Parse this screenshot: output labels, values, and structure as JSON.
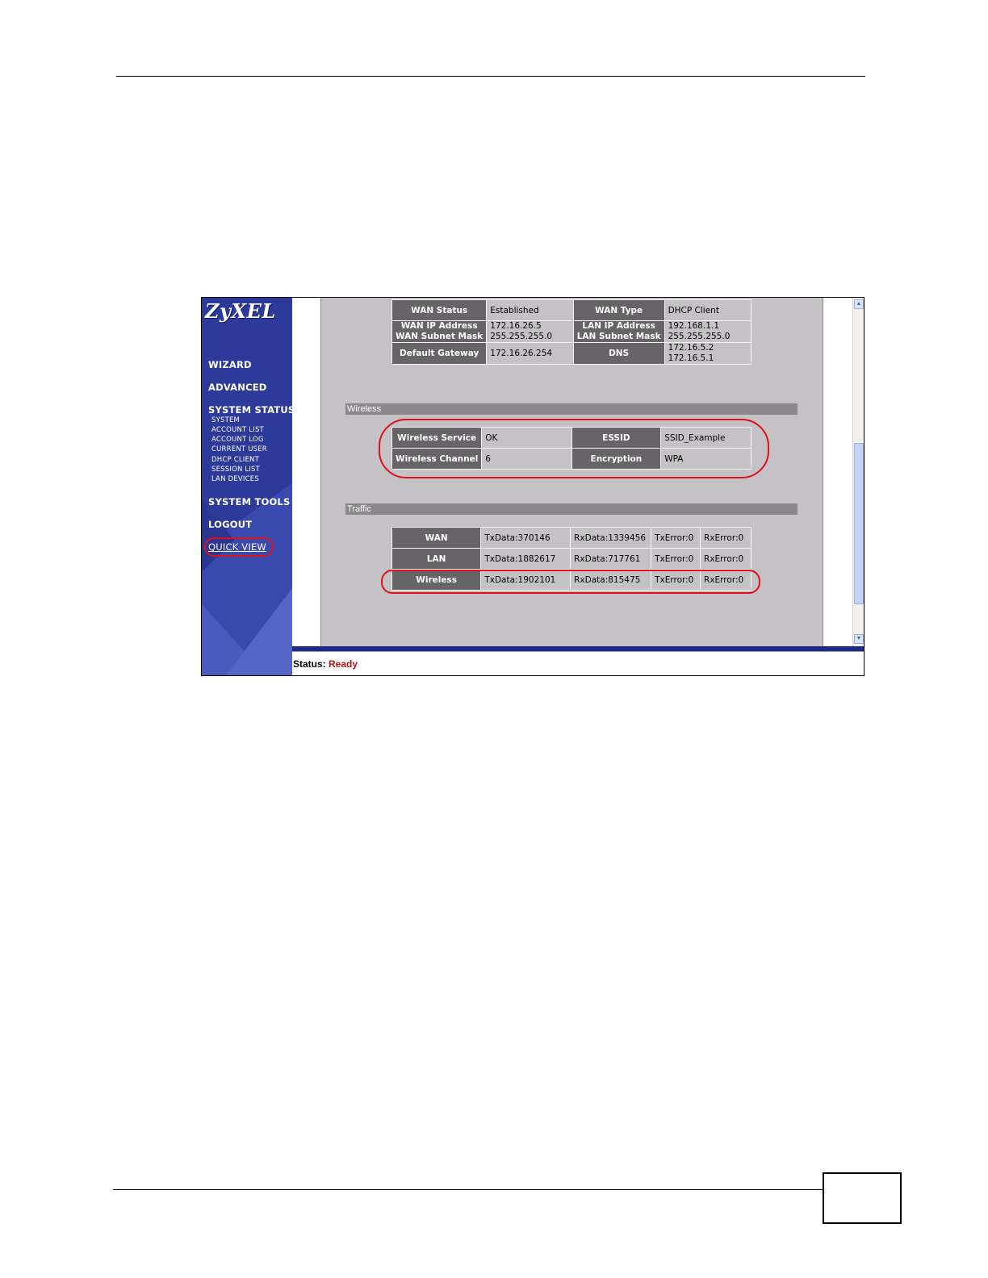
{
  "sidebar": {
    "logo": "ZyXEL",
    "wizard": "WIZARD",
    "advanced": "ADVANCED",
    "system_status": "SYSTEM STATUS",
    "sub_items": [
      "SYSTEM",
      "ACCOUNT LIST",
      "ACCOUNT LOG",
      "CURRENT USER",
      "DHCP CLIENT",
      "SESSION LIST",
      "LAN DEVICES"
    ],
    "system_tools": "SYSTEM TOOLS",
    "logout": "LOGOUT",
    "quick_view": "QUICK VIEW"
  },
  "wan": {
    "status_label": "WAN Status",
    "status_value": "Established",
    "type_label": "WAN Type",
    "type_value": "DHCP Client",
    "ip_label": "WAN IP Address",
    "mask_label": "WAN Subnet Mask",
    "ip_value": "172.16.26.5",
    "mask_value": "255.255.255.0",
    "lan_ip_label": "LAN IP Address",
    "lan_mask_label": "LAN Subnet Mask",
    "lan_ip_value": "192.168.1.1",
    "lan_mask_value": "255.255.255.0",
    "gateway_label": "Default Gateway",
    "gateway_value": "172.16.26.254",
    "dns_label": "DNS",
    "dns_value_1": "172.16.5.2",
    "dns_value_2": "172.16.5.1"
  },
  "wireless": {
    "section_title": "Wireless",
    "service_label": "Wireless Service",
    "service_value": "OK",
    "essid_label": "ESSID",
    "essid_value": "SSID_Example",
    "channel_label": "Wireless Channel",
    "channel_value": "6",
    "encryption_label": "Encryption",
    "encryption_value": "WPA"
  },
  "traffic": {
    "section_title": "Traffic",
    "rows": [
      {
        "name": "WAN",
        "tx": "TxData:370146",
        "rx": "RxData:1339456",
        "txerr": "TxError:0",
        "rxerr": "RxError:0"
      },
      {
        "name": "LAN",
        "tx": "TxData:1882617",
        "rx": "RxData:717761",
        "txerr": "TxError:0",
        "rxerr": "RxError:0"
      },
      {
        "name": "Wireless",
        "tx": "TxData:1902101",
        "rx": "RxData:815475",
        "txerr": "TxError:0",
        "rxerr": "RxError:0"
      }
    ]
  },
  "status_bar": {
    "label": "Status:",
    "value": "Ready"
  },
  "colors": {
    "sidebar": "#2d3a9a",
    "highlight": "#e0101a",
    "status_ready": "#c01010"
  }
}
